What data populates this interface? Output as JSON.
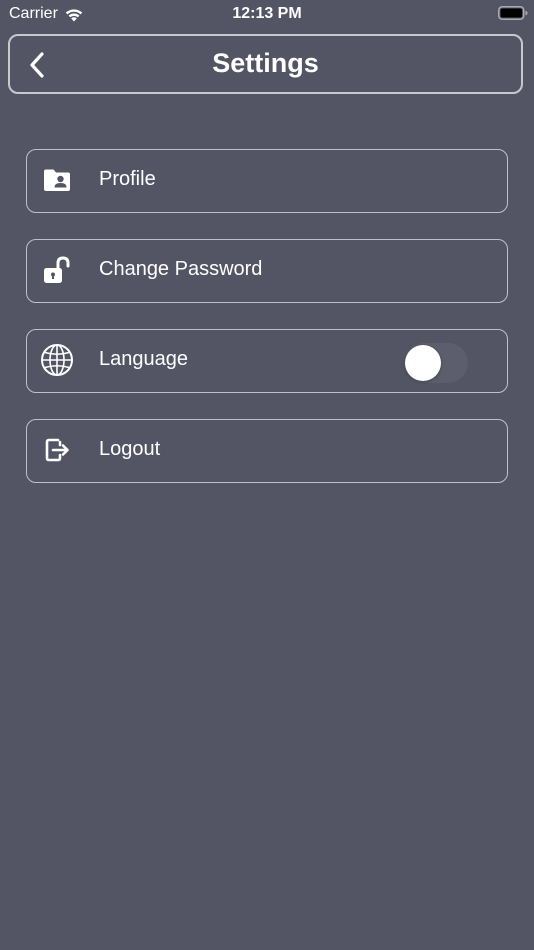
{
  "status_bar": {
    "carrier": "Carrier",
    "time": "12:13 PM",
    "wifi_icon": "wifi-icon",
    "battery_icon": "battery-icon"
  },
  "header": {
    "title": "Settings",
    "back_icon": "chevron-left-icon"
  },
  "menu": {
    "items": [
      {
        "label": "Profile",
        "icon": "profile-folder-icon"
      },
      {
        "label": "Change Password",
        "icon": "unlock-icon"
      },
      {
        "label": "Language",
        "icon": "globe-icon",
        "toggle_on": false
      },
      {
        "label": "Logout",
        "icon": "logout-icon"
      }
    ]
  },
  "colors": {
    "background": "#535565",
    "border": "#c8c8cf",
    "text": "#ffffff",
    "toggle_track": "#5c5e6d"
  }
}
